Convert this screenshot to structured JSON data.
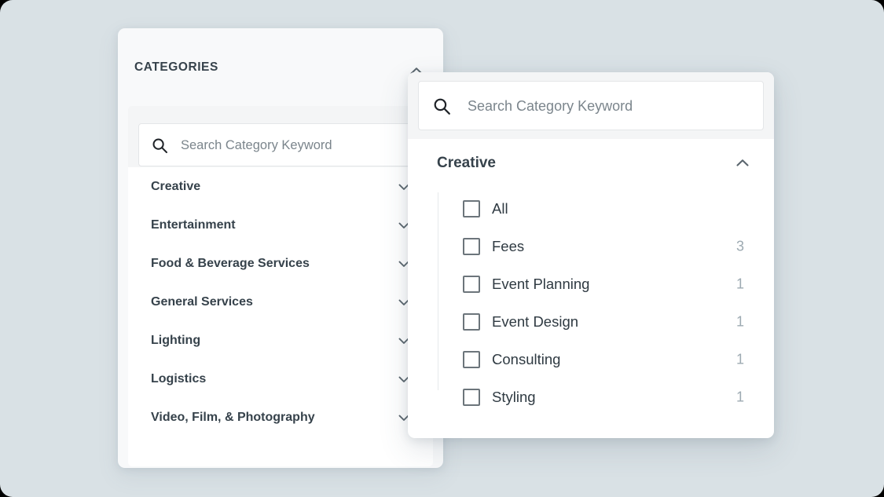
{
  "theme": {
    "page_background": "#d9e1e5",
    "panel_background": "#f8f9fa",
    "card_background": "#ffffff",
    "band_background": "#f4f5f6",
    "text_primary": "#36424b",
    "text_secondary": "#2f3a42",
    "placeholder": "#7b858c",
    "count_color": "#9daab2",
    "checkbox_border": "#6c757b",
    "divider": "#e6e9eb"
  },
  "left_panel": {
    "title": "CATEGORIES",
    "collapse_icon": "chevron-up-icon",
    "search": {
      "icon": "search-icon",
      "placeholder": "Search Category Keyword",
      "value": ""
    },
    "categories": [
      {
        "label": "Creative",
        "icon": "chevron-down-icon"
      },
      {
        "label": "Entertainment",
        "icon": "chevron-down-icon"
      },
      {
        "label": "Food & Beverage Services",
        "icon": "chevron-down-icon"
      },
      {
        "label": "General Services",
        "icon": "chevron-down-icon"
      },
      {
        "label": "Lighting",
        "icon": "chevron-down-icon"
      },
      {
        "label": "Logistics",
        "icon": "chevron-down-icon"
      },
      {
        "label": "Video, Film, & Photography",
        "icon": "chevron-down-icon"
      }
    ]
  },
  "right_panel": {
    "search": {
      "icon": "search-icon",
      "placeholder": "Search Category Keyword",
      "value": ""
    },
    "group": {
      "title": "Creative",
      "collapse_icon": "chevron-up-icon",
      "expanded": true
    },
    "options": [
      {
        "label": "All",
        "count": "",
        "checked": false
      },
      {
        "label": "Fees",
        "count": "3",
        "checked": false
      },
      {
        "label": "Event Planning",
        "count": "1",
        "checked": false
      },
      {
        "label": "Event Design",
        "count": "1",
        "checked": false
      },
      {
        "label": "Consulting",
        "count": "1",
        "checked": false
      },
      {
        "label": "Styling",
        "count": "1",
        "checked": false
      }
    ]
  }
}
